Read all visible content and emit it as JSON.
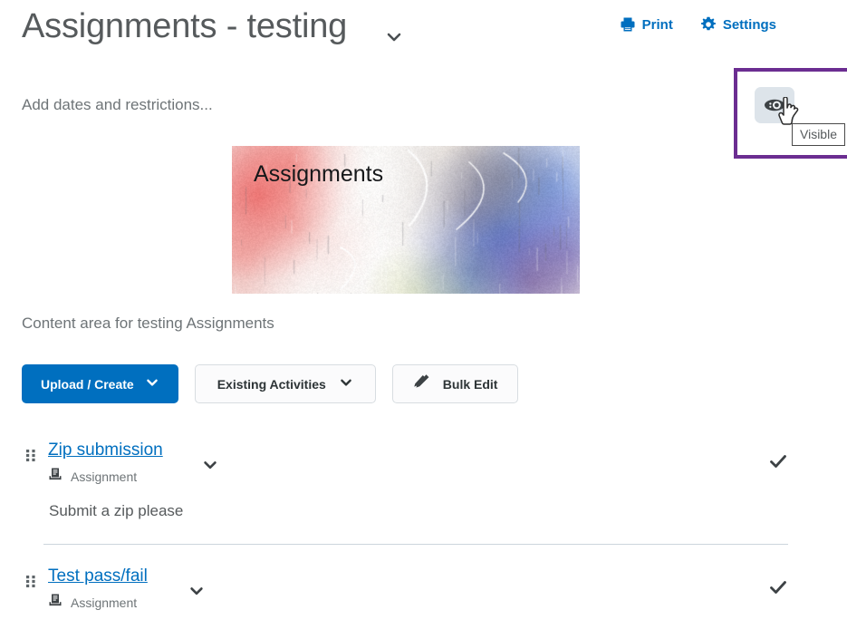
{
  "header": {
    "title": "Assignments - testing",
    "title_chevron_icon": "chevron-down-icon",
    "actions": [
      {
        "label": "Print",
        "icon": "printer-icon"
      },
      {
        "label": "Settings",
        "icon": "gear-icon"
      }
    ],
    "accent_color": "#006fbf"
  },
  "dates": {
    "label": "Add dates and restrictions..."
  },
  "visibility": {
    "highlight_color": "#6b2d91",
    "eye_icon": "eye-visible-icon",
    "cursor_icon": "pointer-hand-cursor-icon",
    "tooltip": "Visible"
  },
  "banner": {
    "label": "Assignments",
    "alt": "watercolor-abstract-banner-image"
  },
  "main": {
    "description": "Content area for testing Assignments"
  },
  "toolbar": {
    "buttons": [
      {
        "label": "Upload / Create",
        "icon": "chevron-down-icon",
        "style": "primary"
      },
      {
        "label": "Existing Activities",
        "icon": "chevron-down-icon",
        "style": "secondary"
      },
      {
        "label": "Bulk Edit",
        "icon": "pencil-edit-icon",
        "style": "secondary"
      }
    ]
  },
  "activities": [
    {
      "title": "Zip submission",
      "type": "Assignment",
      "type_icon": "assignment-document-icon",
      "drag_icon": "drag-handle-icon",
      "chevron_icon": "chevron-down-icon",
      "status_icon": "checkmark-icon",
      "description": "Submit a zip please"
    },
    {
      "title": "Test pass/fail",
      "type": "Assignment",
      "type_icon": "assignment-document-icon",
      "drag_icon": "drag-handle-icon",
      "chevron_icon": "chevron-down-icon",
      "status_icon": "checkmark-icon",
      "description": ""
    }
  ]
}
